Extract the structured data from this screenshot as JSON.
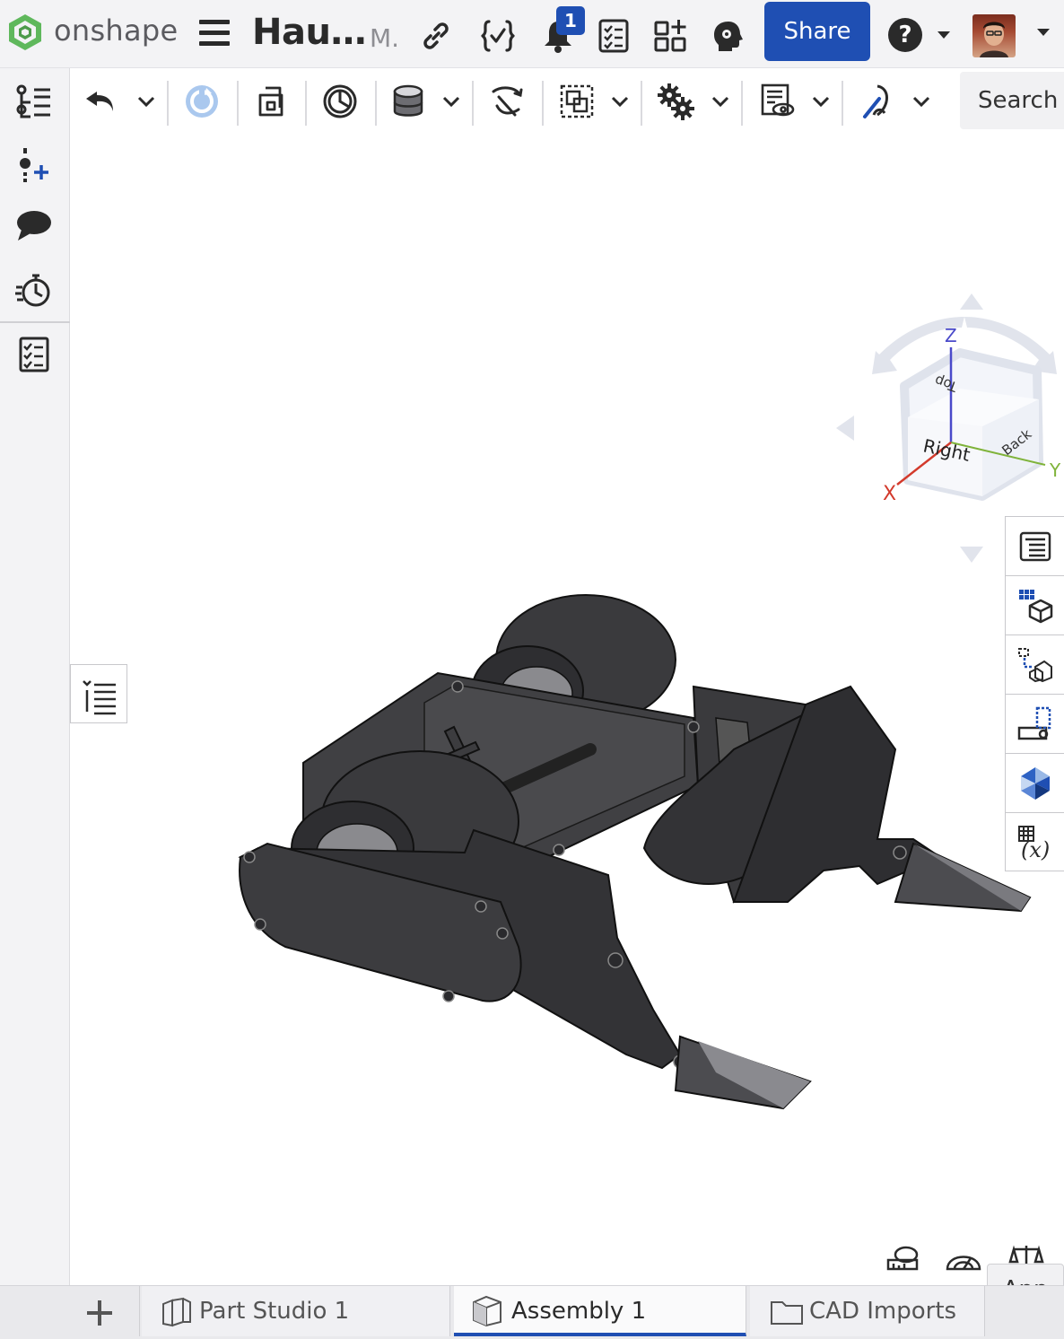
{
  "app": {
    "brand": "onshape",
    "document_title": "Hau…",
    "document_subtitle": "M.",
    "notification_count": "1",
    "share_label": "Share",
    "help_label": "?"
  },
  "sidebar": {
    "items": [
      {
        "icon": "feature-list-icon"
      },
      {
        "icon": "insert-icon"
      },
      {
        "icon": "comments-icon"
      },
      {
        "icon": "versions-history-icon"
      },
      {
        "icon": "tasks-checklist-icon"
      }
    ]
  },
  "toolbar": {
    "tools": [
      "undo-icon",
      "regenerate-icon",
      "derived-icon",
      "section-view-icon",
      "mass-cylinder-icon",
      "mate-connector-icon",
      "transform-icon",
      "settings-gears-icon",
      "named-views-icon",
      "sketch-curve-icon"
    ],
    "search_placeholder": "Search"
  },
  "viewcube": {
    "axis_z": "Z",
    "axis_x": "X",
    "axis_y": "Y",
    "face_top": "Top",
    "face_right": "Right",
    "face_back": "Back"
  },
  "right_panel": {
    "items": [
      "instances-list-icon",
      "bill-of-materials-icon",
      "explode-view-icon",
      "mate-values-icon",
      "appearance-icon",
      "variables-icon"
    ]
  },
  "bottom": {
    "app_label": "App",
    "tabs": [
      {
        "label": "Part Studio 1",
        "icon": "part-studio-icon",
        "active": false
      },
      {
        "label": "Assembly 1",
        "icon": "assembly-icon",
        "active": true
      },
      {
        "label": "CAD Imports",
        "icon": "folder-icon",
        "active": false
      }
    ]
  },
  "colors": {
    "accent": "#1f4fb3",
    "model_body": "#3a3a3d",
    "axis_x": "#d33a2c",
    "axis_y": "#7fb33a",
    "axis_z": "#4a4aca"
  }
}
